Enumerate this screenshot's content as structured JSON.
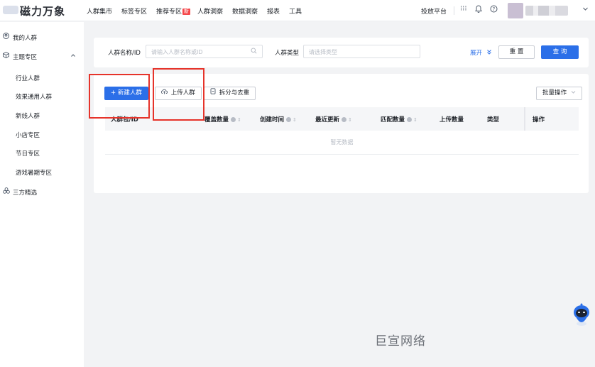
{
  "brand": {
    "name": "磁力万象"
  },
  "topnav": {
    "items": [
      {
        "label": "人群集市"
      },
      {
        "label": "标签专区"
      },
      {
        "label": "推荐专区",
        "badge": "新"
      },
      {
        "label": "人群洞察"
      },
      {
        "label": "数据洞察"
      },
      {
        "label": "报表"
      },
      {
        "label": "工具"
      }
    ],
    "platform_label": "投放平台",
    "icons": [
      "apps-grid-icon",
      "bell-icon",
      "help-icon",
      "chevron-down-icon"
    ]
  },
  "sidebar": {
    "items": [
      {
        "label": "我的人群",
        "icon": "user-circle-icon"
      },
      {
        "label": "主题专区",
        "icon": "cube-icon",
        "expanded": true
      },
      {
        "label": "行业人群"
      },
      {
        "label": "效果通用人群"
      },
      {
        "label": "新线人群"
      },
      {
        "label": "小店专区"
      },
      {
        "label": "节日专区"
      },
      {
        "label": "游戏暑期专区"
      },
      {
        "label": "三方精选",
        "icon": "three-circles-icon"
      }
    ]
  },
  "search": {
    "name_label": "人群名称/ID",
    "name_placeholder": "请输入人群名称或ID",
    "type_label": "人群类型",
    "type_placeholder": "请选择类型",
    "expand_label": "展开",
    "reset_label": "重 置",
    "query_label": "查 询"
  },
  "toolbar": {
    "new_label": "+ 新建人群",
    "upload_label": "上传人群",
    "split_label": "拆分与去重",
    "batch_label": "批量操作"
  },
  "table": {
    "columns": [
      {
        "label": "人群包/ID"
      },
      {
        "label": "覆盖数量",
        "help": true,
        "sortable": true
      },
      {
        "label": "创建时间",
        "help": true,
        "sortable": true
      },
      {
        "label": "最近更新",
        "help": true,
        "sortable": true
      },
      {
        "label": "匹配数量",
        "help": true,
        "sortable": true
      },
      {
        "label": "上传数量"
      },
      {
        "label": "类型"
      },
      {
        "label": "操作"
      }
    ],
    "empty_text": "暂无数据"
  },
  "watermark": "巨宣网络",
  "colors": {
    "primary": "#2b6fe8",
    "highlight": "#e6332a"
  }
}
